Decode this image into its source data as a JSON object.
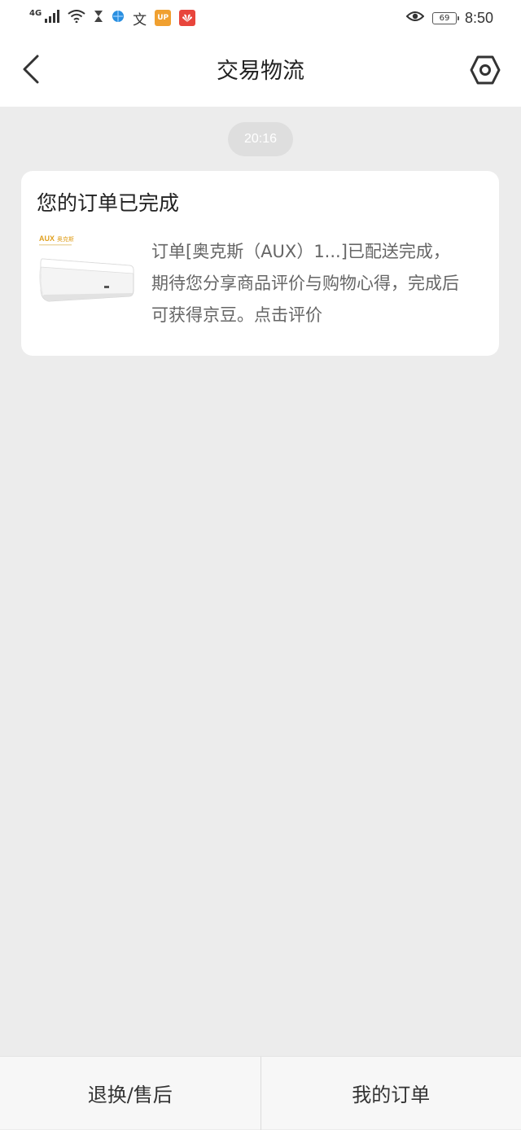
{
  "status_bar": {
    "network": "4G",
    "battery": "69",
    "time": "8:50",
    "icons": [
      "signal-icon",
      "wifi-icon",
      "hourglass-icon",
      "browser-icon",
      "translate-icon",
      "unionpay-icon",
      "huawei-icon",
      "eye-icon"
    ],
    "badges": {
      "up": "UP",
      "text_glyph": "文"
    }
  },
  "header": {
    "title": "交易物流",
    "back_icon": "chevron-left-icon",
    "settings_icon": "hexagon-settings-icon"
  },
  "timestamp": "20:16",
  "message_card": {
    "title": "您的订单已完成",
    "description": "订单[奥克斯（AUX）1...]已配送完成，期待您分享商品评价与购物心得，完成后可获得京豆。点击评价",
    "product_brand": "AUX",
    "product_brand_cn": "奥克斯"
  },
  "bottom_bar": {
    "returns_label": "退换/售后",
    "orders_label": "我的订单"
  },
  "colors": {
    "background": "#ececec",
    "card": "#ffffff",
    "brand_orange": "#e0a020",
    "unionpay_orange": "#f0a030",
    "huawei_red": "#e8453c"
  }
}
